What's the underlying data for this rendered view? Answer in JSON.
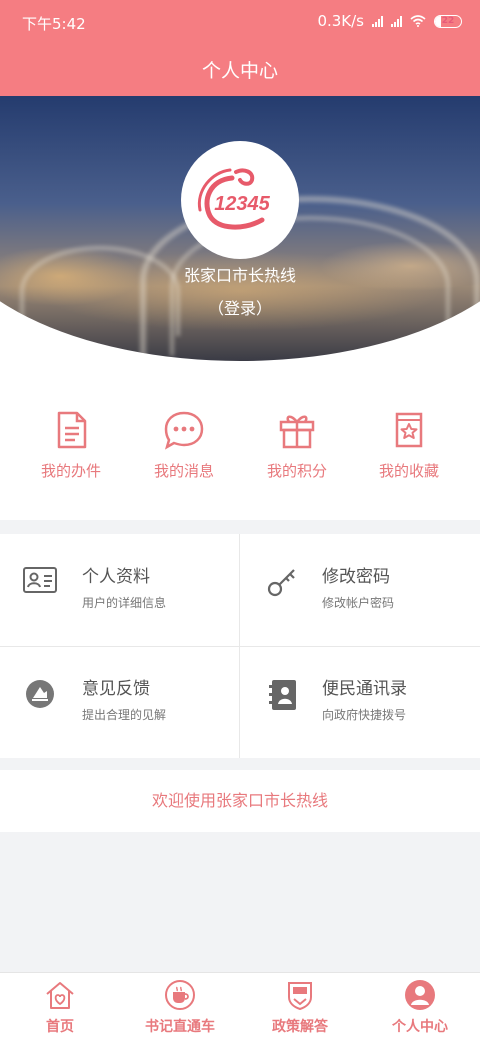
{
  "status_bar": {
    "time": "下午5:42",
    "network_speed": "0.3K/s",
    "battery": "22"
  },
  "header": {
    "title": "个人中心"
  },
  "profile": {
    "logo_text": "12345",
    "name": "张家口市长热线",
    "login_label": "（登录）"
  },
  "quick_actions": [
    {
      "label": "我的办件",
      "icon": "document-icon"
    },
    {
      "label": "我的消息",
      "icon": "chat-bubble-icon"
    },
    {
      "label": "我的积分",
      "icon": "gift-icon"
    },
    {
      "label": "我的收藏",
      "icon": "star-book-icon"
    }
  ],
  "menu": [
    {
      "title": "个人资料",
      "subtitle": "用户的详细信息",
      "icon": "id-card-icon"
    },
    {
      "title": "修改密码",
      "subtitle": "修改帐户密码",
      "icon": "key-icon"
    },
    {
      "title": "意见反馈",
      "subtitle": "提出合理的见解",
      "icon": "feedback-icon"
    },
    {
      "title": "便民通讯录",
      "subtitle": "向政府快捷拨号",
      "icon": "contact-book-icon"
    }
  ],
  "welcome_text": "欢迎使用张家口市长热线",
  "bottom_nav": [
    {
      "label": "首页",
      "icon": "home-heart-icon"
    },
    {
      "label": "书记直通车",
      "icon": "coffee-cup-icon"
    },
    {
      "label": "政策解答",
      "icon": "policy-badge-icon"
    },
    {
      "label": "个人中心",
      "icon": "user-icon",
      "active": true
    }
  ],
  "colors": {
    "brand": "#f57d82",
    "accent_text": "#e8797d",
    "page_bg": "#f2f3f5"
  }
}
